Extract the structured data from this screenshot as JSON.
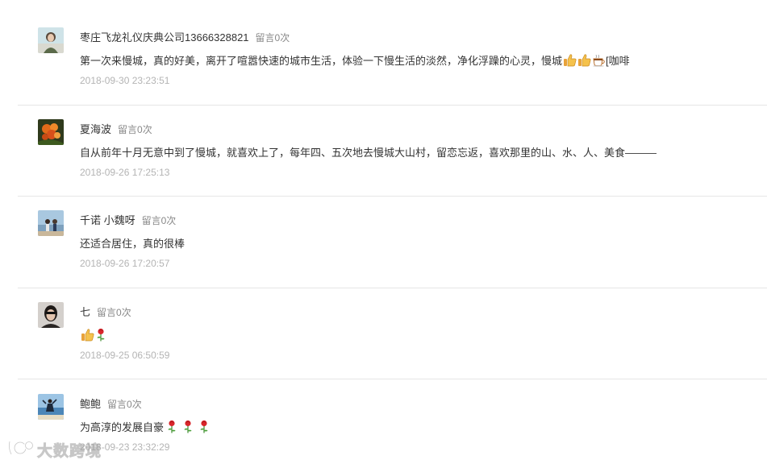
{
  "comments": [
    {
      "nickname": "枣庄飞龙礼仪庆典公司13666328821",
      "msg_count": "留言0次",
      "content": "第一次来慢城，真的好美，离开了喧嚣快速的城市生活，体验一下慢生活的淡然，净化浮躁的心灵，慢城",
      "content_tail": "[咖啡",
      "emojis": [
        "thumbs-up",
        "thumbs-up",
        "coffee"
      ],
      "time": "2018-09-30 23:23:51"
    },
    {
      "nickname": "夏海波",
      "msg_count": "留言0次",
      "content": "自从前年十月无意中到了慢城，就喜欢上了，每年四、五次地去慢城大山村，留恋忘返，喜欢那里的山、水、人、美食———",
      "time": "2018-09-26 17:25:13"
    },
    {
      "nickname": "千诺 小魏呀",
      "msg_count": "留言0次",
      "content": "还适合居住，真的很棒",
      "time": "2018-09-26 17:20:57"
    },
    {
      "nickname": "七",
      "msg_count": "留言0次",
      "content": "",
      "emojis": [
        "thumbs-up",
        "rose"
      ],
      "time": "2018-09-25 06:50:59"
    },
    {
      "nickname": "鲍鲍",
      "msg_count": "留言0次",
      "content": "为高淳的发展自豪",
      "emojis": [
        "rose",
        "rose",
        "rose"
      ],
      "time": "2018-09-23 23:32:29"
    }
  ],
  "watermark": {
    "text": "大数跨境"
  }
}
